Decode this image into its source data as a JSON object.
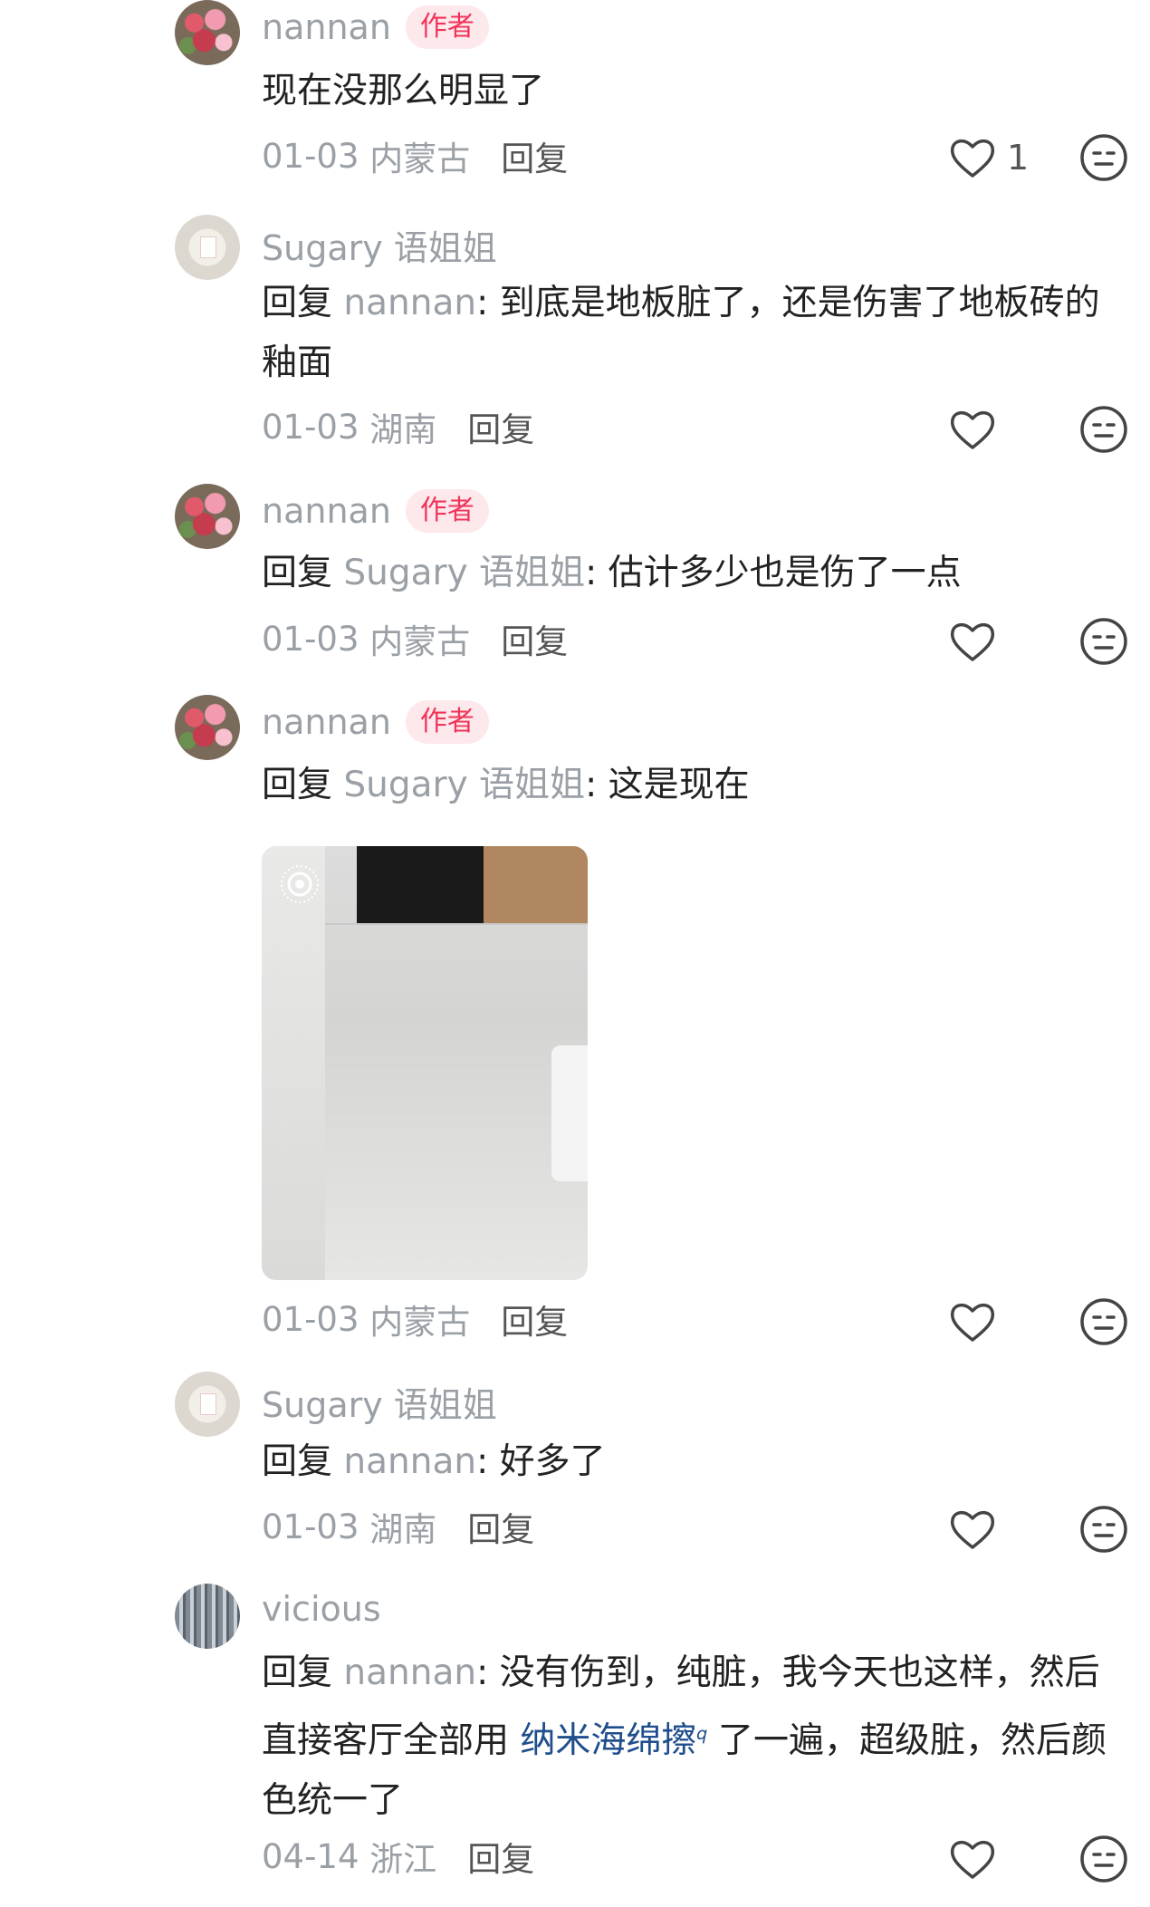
{
  "comments": [
    {
      "name": "nannan",
      "author_badge": "作者",
      "text": "现在没那么明显了",
      "date": "01-03",
      "location": "内蒙古",
      "reply_label": "回复",
      "likes": "1",
      "avatar": "flower-avatar"
    },
    {
      "name": "Sugary 语姐姐",
      "reply_prefix": "回复",
      "mention": "nannan",
      "text": ": 到底是地板脏了，还是伤害了地板砖的釉面",
      "date": "01-03",
      "location": "湖南",
      "reply_label": "回复",
      "avatar": "sugary-avatar"
    },
    {
      "name": "nannan",
      "author_badge": "作者",
      "reply_prefix": "回复",
      "mention": "Sugary 语姐姐",
      "text": ": 估计多少也是伤了一点",
      "date": "01-03",
      "location": "内蒙古",
      "reply_label": "回复",
      "avatar": "flower-avatar"
    },
    {
      "name": "nannan",
      "author_badge": "作者",
      "reply_prefix": "回复",
      "mention": "Sugary 语姐姐",
      "text": ": 这是现在",
      "date": "01-03",
      "location": "内蒙古",
      "reply_label": "回复",
      "avatar": "flower-avatar",
      "has_photo": true
    },
    {
      "name": "Sugary 语姐姐",
      "reply_prefix": "回复",
      "mention": "nannan",
      "text": ": 好多了",
      "date": "01-03",
      "location": "湖南",
      "reply_label": "回复",
      "avatar": "sugary-avatar"
    },
    {
      "name": "vicious",
      "reply_prefix": "回复",
      "mention": "nannan",
      "text_before": ": 没有伤到，纯脏，我今天也这样，然后直接客厅全部用 ",
      "link_text": "纳米海绵擦",
      "text_after": " 了一遍，超级脏，然后颜色统一了",
      "date": "04-14",
      "location": "浙江",
      "reply_label": "回复",
      "avatar": "vicious-avatar"
    }
  ],
  "colors": {
    "author_badge_bg": "#fde8ec",
    "author_badge_text": "#f0345a",
    "username": "#9aa0a6",
    "link": "#1f4e8c"
  }
}
